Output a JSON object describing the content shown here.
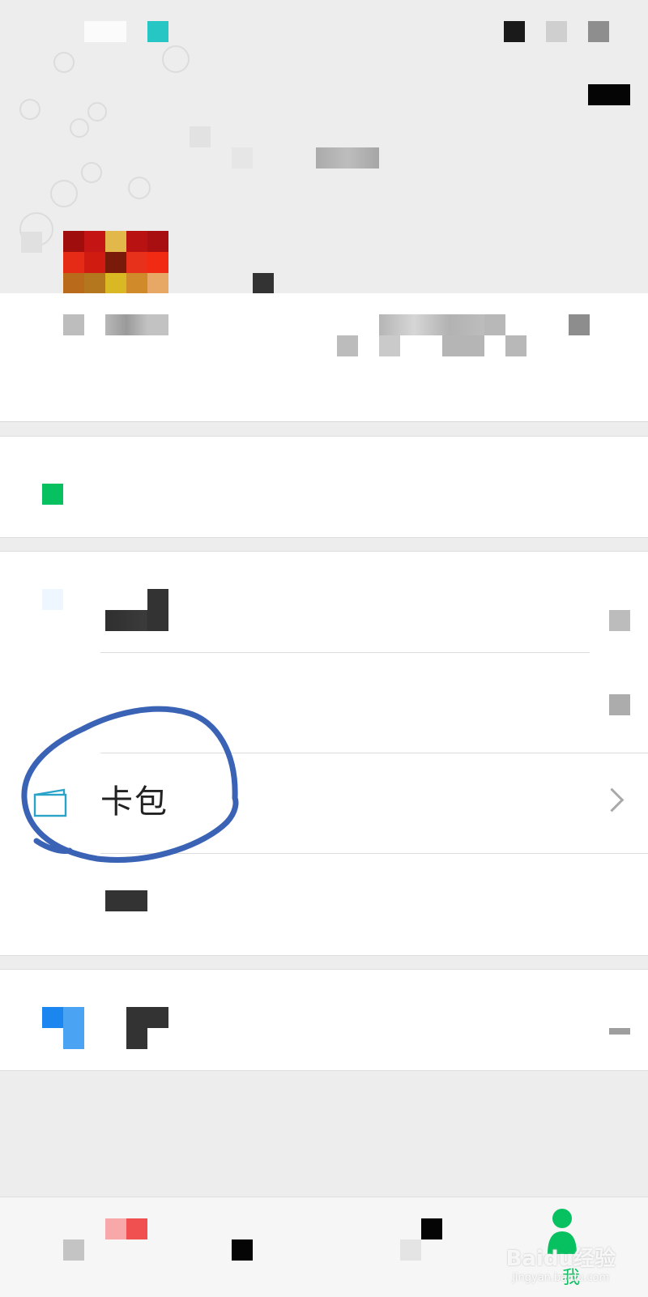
{
  "colors": {
    "accent": "#07c160",
    "annotation_circle": "#3a62b5",
    "card_icon": "#2aa3c8",
    "background": "#ededed",
    "card": "#ffffff"
  },
  "status_bar": {
    "blurred": true
  },
  "profile": {
    "avatar_icon": "avatar-icon",
    "blurred_text": true
  },
  "pay_section": {
    "icon": "pay-icon",
    "label_blurred": true
  },
  "list_section": {
    "items": [
      {
        "icon": "favorites-icon",
        "label_blurred": true
      },
      {
        "icon": "moments-icon",
        "label_blurred": true
      },
      {
        "icon": "card-wallet-icon",
        "label": "卡包"
      },
      {
        "icon": "emoji-icon",
        "label_blurred": true
      }
    ]
  },
  "settings_section": {
    "icon": "settings-icon",
    "label_blurred": true
  },
  "tabbar": {
    "tabs": [
      {
        "icon": "chats-icon",
        "active": false
      },
      {
        "icon": "contacts-icon",
        "active": false
      },
      {
        "icon": "discover-icon",
        "active": false
      },
      {
        "icon": "me-icon",
        "label": "我",
        "active": true
      }
    ]
  },
  "watermark": {
    "brand": "Baidu经验",
    "url": "jingyan.baidu.com"
  }
}
